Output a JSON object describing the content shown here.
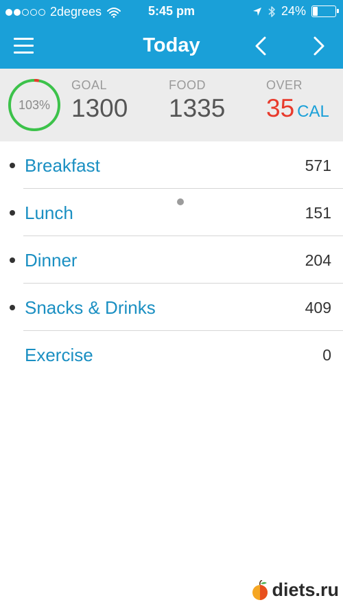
{
  "status_bar": {
    "carrier": "2degrees",
    "time": "5:45 pm",
    "battery_percent": "24%",
    "battery_level": 0.24,
    "signal_bars_filled": 2,
    "signal_bars_total": 5,
    "icons": [
      "wifi-icon",
      "location-arrow-icon",
      "bluetooth-icon",
      "battery-icon"
    ]
  },
  "nav": {
    "title": "Today",
    "icons": [
      "menu-icon",
      "chevron-left-icon",
      "chevron-right-icon"
    ]
  },
  "summary": {
    "progress_percent": "103%",
    "progress_fraction": 1.03,
    "goal_label": "GOAL",
    "goal_value": "1300",
    "food_label": "FOOD",
    "food_value": "1335",
    "over_label": "OVER",
    "over_value": "35",
    "unit": "CAL",
    "pager_pages": 2,
    "pager_active": 0
  },
  "meals": [
    {
      "name": "Breakfast",
      "calories": "571"
    },
    {
      "name": "Lunch",
      "calories": "151"
    },
    {
      "name": "Dinner",
      "calories": "204"
    },
    {
      "name": "Snacks & Drinks",
      "calories": "409"
    },
    {
      "name": "Exercise",
      "calories": "0"
    }
  ],
  "watermark": {
    "text": "diets.ru",
    "icon": "apple-logo"
  },
  "colors": {
    "brand": "#1aa0d8",
    "link": "#1a8fc2",
    "over": "#e83a2c",
    "ring_ok": "#3cc24a",
    "ring_over": "#e83a2c",
    "panel": "#ececec"
  }
}
